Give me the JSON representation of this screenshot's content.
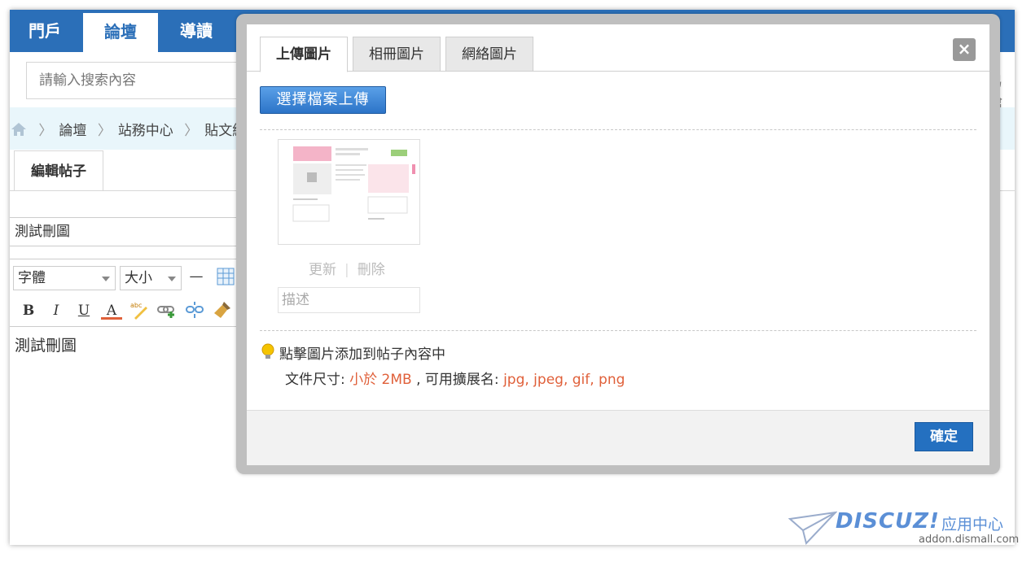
{
  "nav": {
    "items": [
      "門戶",
      "論壇",
      "導讀"
    ],
    "active": "論壇"
  },
  "search": {
    "placeholder": "請輸入搜索內容"
  },
  "right_cut_text": "易槍",
  "breadcrumb": {
    "items": [
      "論壇",
      "站務中心",
      "貼文練習"
    ]
  },
  "editor": {
    "tab": "編輯帖子",
    "subject": "測試刪圖",
    "font_select": "字體",
    "size_select": "大小",
    "body": "測試刪圖",
    "toolbar": {
      "bold": "B",
      "italic": "I",
      "underline": "U",
      "color": "A"
    }
  },
  "modal": {
    "tabs": [
      "上傳圖片",
      "相冊圖片",
      "網絡圖片"
    ],
    "active_tab": "上傳圖片",
    "close": "×",
    "upload_button": "選擇檔案上傳",
    "thumb_actions": {
      "update": "更新",
      "delete": "刪除"
    },
    "description_placeholder": "描述",
    "hint": "點擊圖片添加到帖子內容中",
    "info": {
      "size_label": "文件尺寸:",
      "size_value": "小於 2MB",
      "ext_label": ", 可用擴展名:",
      "ext_value": "jpg, jpeg, gif, png"
    },
    "confirm": "確定"
  },
  "watermark": {
    "brand": "DISCUZ!",
    "app_center": "应用中心",
    "url": "addon.dismall.com"
  },
  "colors": {
    "nav": "#2b6fb8",
    "accent_red": "#e0603a",
    "button_blue": "#2470c0"
  }
}
